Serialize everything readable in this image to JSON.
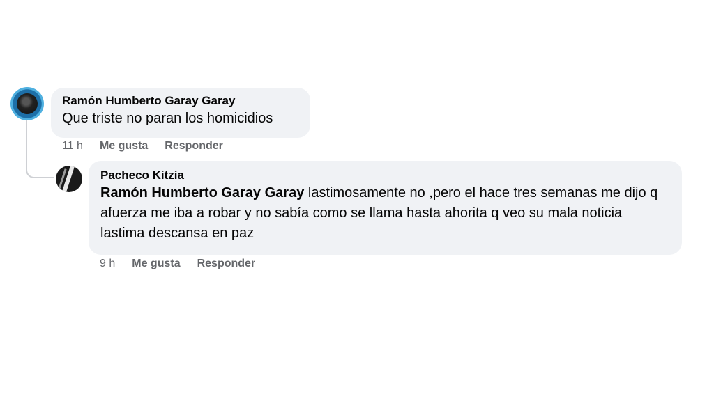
{
  "comments": [
    {
      "author": "Ramón Humberto Garay Garay",
      "text": "Que triste no paran los homicidios",
      "time": "11 h",
      "like_label": "Me gusta",
      "reply_label": "Responder"
    },
    {
      "author": "Pacheco Kitzia",
      "mention": "Ramón Humberto Garay Garay",
      "text": " lastimosamente no ,pero el hace tres semanas me dijo q afuerza me iba a robar y no sabía como se llama hasta ahorita q veo su mala noticia lastima descansa en paz",
      "time": "9 h",
      "like_label": "Me gusta",
      "reply_label": "Responder"
    }
  ],
  "colors": {
    "bubble": "#f0f2f5",
    "meta_text": "#65676b",
    "thread_line": "#ced0d4"
  }
}
